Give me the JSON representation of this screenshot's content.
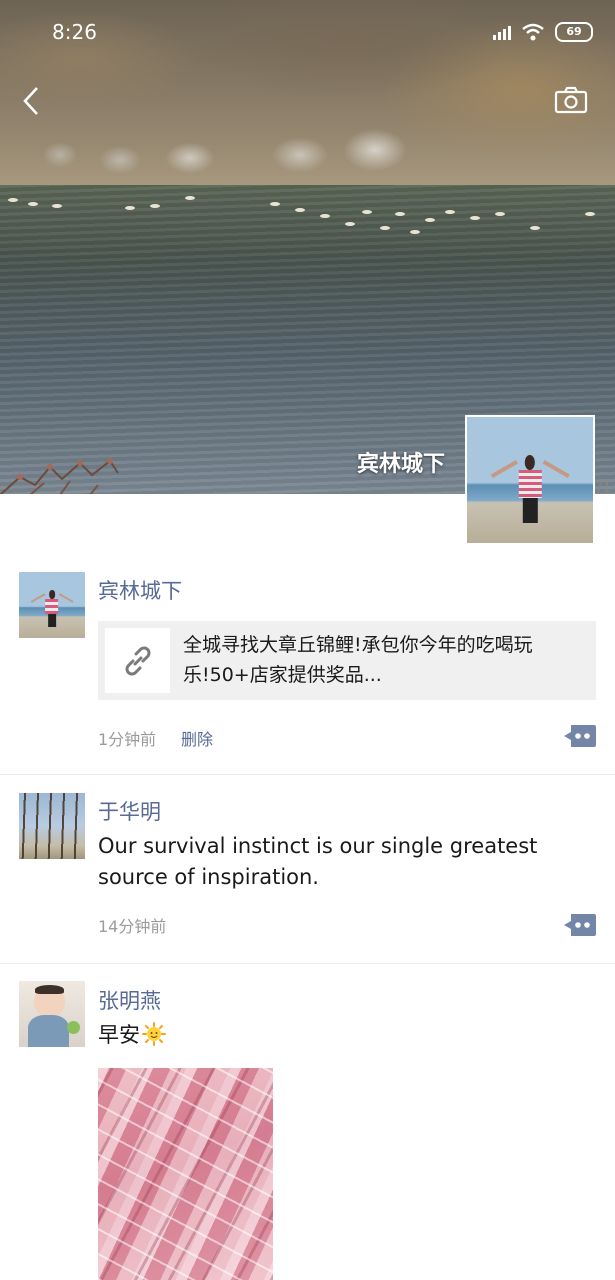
{
  "status_bar": {
    "time": "8:26",
    "battery": "69",
    "icons": [
      "signal-icon",
      "wifi-icon",
      "battery-icon"
    ]
  },
  "header": {
    "back_icon": "back-arrow-icon",
    "camera_icon": "camera-icon"
  },
  "cover": {
    "user_name": "宾林城下",
    "edge_text": "/1"
  },
  "posts": [
    {
      "name": "宾林城下",
      "link_title": "全城寻找大章丘锦鲤!承包你今年的吃喝玩乐!50+店家提供奖品...",
      "link_icon": "link-icon",
      "time": "1分钟前",
      "delete_label": "删除"
    },
    {
      "name": "于华明",
      "text": "Our survival instinct is our single greatest source of inspiration.",
      "time": "14分钟前"
    },
    {
      "name": "张明燕",
      "text": "早安",
      "emoji": "sun-emoji"
    }
  ],
  "colors": {
    "name_blue": "#576b95",
    "time_gray": "#9b9b9b",
    "link_bg": "#f0f0f0",
    "comment_btn": "#7386a8"
  }
}
